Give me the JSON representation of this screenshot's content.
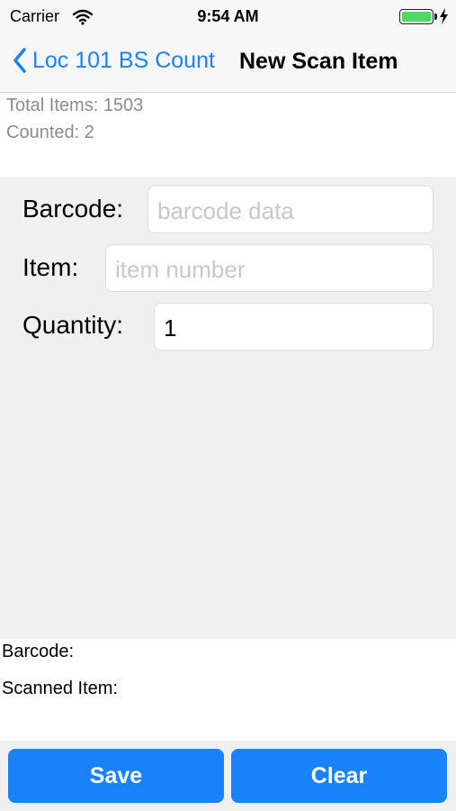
{
  "status_bar": {
    "carrier": "Carrier",
    "time": "9:54 AM"
  },
  "nav": {
    "back_label": "Loc 101 BS Count",
    "title": "New Scan Item"
  },
  "summary": {
    "total_items": "Total Items: 1503",
    "counted": "Counted: 2"
  },
  "form": {
    "barcode_label": "Barcode:",
    "barcode_placeholder": "barcode data",
    "barcode_value": "",
    "item_label": "Item:",
    "item_placeholder": "item number",
    "item_value": "",
    "quantity_label": "Quantity:",
    "quantity_value": "1"
  },
  "scan_info": {
    "barcode_label": "Barcode:",
    "scanned_item_label": "Scanned Item:"
  },
  "actions": {
    "save_label": "Save",
    "clear_label": "Clear"
  },
  "colors": {
    "accent": "#1a82fb",
    "battery": "#4cd964"
  }
}
